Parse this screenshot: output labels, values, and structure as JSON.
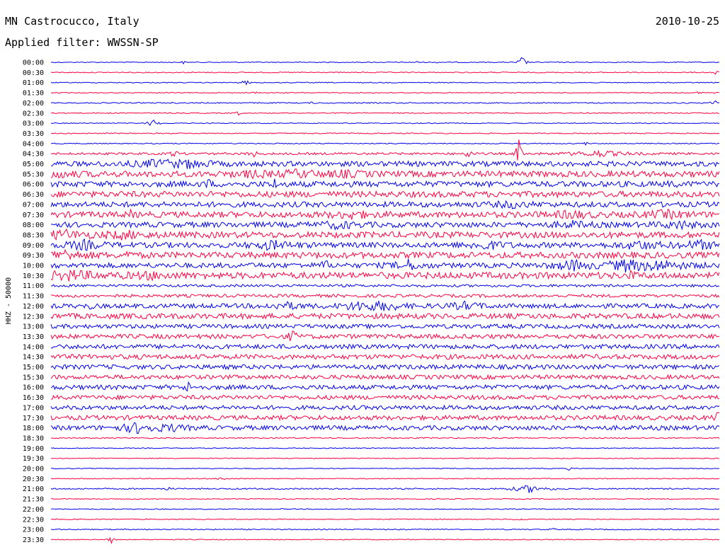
{
  "header": {
    "station": "MN Castrocucco, Italy",
    "filter": "Applied filter: WWSSN-SP",
    "date": "2010-10-25"
  },
  "chart_data": {
    "type": "line",
    "ylabel": "HHZ - 50000",
    "colors": [
      "#0000ee",
      "#ff0040"
    ],
    "rows": [
      {
        "time": "00:00",
        "noise": 0.6,
        "events": [
          {
            "t": 0.198,
            "a": 2,
            "w": 0.002
          },
          {
            "t": 0.547,
            "a": 2,
            "w": 0.002
          },
          {
            "t": 0.58,
            "a": 2,
            "w": 0.002
          },
          {
            "t": 0.705,
            "a": 10,
            "w": 0.004
          }
        ]
      },
      {
        "time": "00:30",
        "noise": 0.7,
        "events": [
          {
            "t": 0.994,
            "a": 7,
            "w": 0.002
          }
        ]
      },
      {
        "time": "01:00",
        "noise": 0.6,
        "events": [
          {
            "t": 0.291,
            "a": 4,
            "w": 0.004
          }
        ]
      },
      {
        "time": "01:30",
        "noise": 0.6,
        "events": [
          {
            "t": 0.305,
            "a": 2,
            "w": 0.002
          },
          {
            "t": 0.97,
            "a": 4,
            "w": 0.002
          }
        ]
      },
      {
        "time": "02:00",
        "noise": 0.8,
        "events": [
          {
            "t": 0.392,
            "a": 2,
            "w": 0.002
          },
          {
            "t": 0.998,
            "a": 14,
            "w": 0.004
          }
        ]
      },
      {
        "time": "02:30",
        "noise": 0.7,
        "events": [
          {
            "t": 0.28,
            "a": 3,
            "w": 0.003
          }
        ]
      },
      {
        "time": "03:00",
        "noise": 0.6,
        "events": [
          {
            "t": 0.153,
            "a": 7,
            "w": 0.005
          }
        ]
      },
      {
        "time": "03:30",
        "noise": 0.7,
        "events": []
      },
      {
        "time": "04:00",
        "noise": 0.7,
        "events": [
          {
            "t": 0.8,
            "a": 3,
            "w": 0.002
          }
        ]
      },
      {
        "time": "04:30",
        "noise": 1.6,
        "events": [
          {
            "t": 0.185,
            "a": 5,
            "w": 0.004
          },
          {
            "t": 0.302,
            "a": 6,
            "w": 0.004
          },
          {
            "t": 0.624,
            "a": 7,
            "w": 0.004
          },
          {
            "t": 0.7,
            "a": 22,
            "w": 0.003
          },
          {
            "t": 0.82,
            "a": 4,
            "w": 0.03
          }
        ]
      },
      {
        "time": "05:00",
        "noise": 3.6,
        "events": [
          {
            "t": 0.16,
            "a": 4,
            "w": 0.03
          },
          {
            "t": 0.21,
            "a": 4,
            "w": 0.02
          }
        ]
      },
      {
        "time": "05:30",
        "noise": 4.2,
        "events": [
          {
            "t": 0.012,
            "a": 3,
            "w": 0.02
          },
          {
            "t": 0.3,
            "a": 3,
            "w": 0.02
          },
          {
            "t": 0.37,
            "a": 4,
            "w": 0.02
          },
          {
            "t": 0.44,
            "a": 3,
            "w": 0.02
          }
        ]
      },
      {
        "time": "06:00",
        "noise": 4.0,
        "events": [
          {
            "t": 0.235,
            "a": 6,
            "w": 0.003
          },
          {
            "t": 0.335,
            "a": 6,
            "w": 0.003
          },
          {
            "t": 0.93,
            "a": 5,
            "w": 0.003
          }
        ]
      },
      {
        "time": "06:30",
        "noise": 4.2,
        "events": []
      },
      {
        "time": "07:00",
        "noise": 3.8,
        "events": [
          {
            "t": 0.69,
            "a": 3,
            "w": 0.02
          }
        ]
      },
      {
        "time": "07:30",
        "noise": 4.2,
        "events": [
          {
            "t": 0.12,
            "a": 4,
            "w": 0.003
          },
          {
            "t": 0.45,
            "a": 4,
            "w": 0.02
          },
          {
            "t": 0.78,
            "a": 4,
            "w": 0.02
          },
          {
            "t": 0.92,
            "a": 4,
            "w": 0.02
          }
        ]
      },
      {
        "time": "08:00",
        "noise": 3.8,
        "events": [
          {
            "t": 0.43,
            "a": 4,
            "w": 0.02
          },
          {
            "t": 0.78,
            "a": 3,
            "w": 0.02
          },
          {
            "t": 0.94,
            "a": 4,
            "w": 0.02
          }
        ]
      },
      {
        "time": "08:30",
        "noise": 4.4,
        "events": [
          {
            "t": 0.02,
            "a": 5,
            "w": 0.02
          },
          {
            "t": 0.11,
            "a": 4,
            "w": 0.02
          }
        ]
      },
      {
        "time": "09:00",
        "noise": 3.8,
        "events": [
          {
            "t": 0.05,
            "a": 5,
            "w": 0.02
          },
          {
            "t": 0.33,
            "a": 5,
            "w": 0.02
          },
          {
            "t": 0.65,
            "a": 5,
            "w": 0.02
          },
          {
            "t": 0.88,
            "a": 5,
            "w": 0.02
          },
          {
            "t": 0.97,
            "a": 5,
            "w": 0.02
          }
        ]
      },
      {
        "time": "09:30",
        "noise": 4.4,
        "events": [
          {
            "t": 0.02,
            "a": 5,
            "w": 0.02
          },
          {
            "t": 0.115,
            "a": 5,
            "w": 0.003
          }
        ]
      },
      {
        "time": "10:00",
        "noise": 3.6,
        "events": [
          {
            "t": 0.41,
            "a": 7,
            "w": 0.004
          },
          {
            "t": 0.535,
            "a": 6,
            "w": 0.015
          },
          {
            "t": 0.78,
            "a": 6,
            "w": 0.02
          },
          {
            "t": 0.86,
            "a": 6,
            "w": 0.02
          },
          {
            "t": 0.91,
            "a": 6,
            "w": 0.03
          }
        ]
      },
      {
        "time": "10:30",
        "noise": 4.6,
        "events": [
          {
            "t": 0.03,
            "a": 5,
            "w": 0.03
          },
          {
            "t": 0.15,
            "a": 3,
            "w": 0.02
          },
          {
            "t": 0.87,
            "a": 10,
            "w": 0.002
          }
        ]
      },
      {
        "time": "11:00",
        "noise": 1.8,
        "events": []
      },
      {
        "time": "11:30",
        "noise": 2.2,
        "events": []
      },
      {
        "time": "12:00",
        "noise": 3.2,
        "events": [
          {
            "t": 0.06,
            "a": 4,
            "w": 0.003
          },
          {
            "t": 0.35,
            "a": 4,
            "w": 0.02
          },
          {
            "t": 0.46,
            "a": 5,
            "w": 0.02
          },
          {
            "t": 0.5,
            "a": 5,
            "w": 0.02
          },
          {
            "t": 0.62,
            "a": 4,
            "w": 0.02
          }
        ]
      },
      {
        "time": "12:30",
        "noise": 3.8,
        "events": []
      },
      {
        "time": "13:00",
        "noise": 3.0,
        "events": []
      },
      {
        "time": "13:30",
        "noise": 3.2,
        "events": [
          {
            "t": 0.362,
            "a": 10,
            "w": 0.004
          }
        ]
      },
      {
        "time": "14:00",
        "noise": 3.2,
        "events": []
      },
      {
        "time": "14:30",
        "noise": 3.4,
        "events": []
      },
      {
        "time": "15:00",
        "noise": 3.2,
        "events": []
      },
      {
        "time": "15:30",
        "noise": 3.0,
        "events": []
      },
      {
        "time": "16:00",
        "noise": 3.2,
        "events": [
          {
            "t": 0.205,
            "a": 7,
            "w": 0.003
          }
        ]
      },
      {
        "time": "16:30",
        "noise": 3.0,
        "events": []
      },
      {
        "time": "17:00",
        "noise": 3.0,
        "events": []
      },
      {
        "time": "17:30",
        "noise": 3.2,
        "events": [
          {
            "t": 0.998,
            "a": 7,
            "w": 0.003
          }
        ]
      },
      {
        "time": "18:00",
        "noise": 3.2,
        "events": [
          {
            "t": 0.13,
            "a": 6,
            "w": 0.02
          },
          {
            "t": 0.18,
            "a": 3,
            "w": 0.02
          }
        ]
      },
      {
        "time": "18:30",
        "noise": 0.8,
        "events": []
      },
      {
        "time": "19:00",
        "noise": 0.6,
        "events": []
      },
      {
        "time": "19:30",
        "noise": 0.6,
        "events": []
      },
      {
        "time": "20:00",
        "noise": 0.6,
        "events": [
          {
            "t": 0.775,
            "a": 2,
            "w": 0.002
          }
        ]
      },
      {
        "time": "20:30",
        "noise": 0.6,
        "events": [
          {
            "t": 0.255,
            "a": 5,
            "w": 0.003
          }
        ]
      },
      {
        "time": "21:00",
        "noise": 0.9,
        "events": [
          {
            "t": 0.175,
            "a": 2,
            "w": 0.005
          },
          {
            "t": 0.715,
            "a": 5,
            "w": 0.02
          }
        ]
      },
      {
        "time": "21:30",
        "noise": 0.6,
        "events": []
      },
      {
        "time": "22:00",
        "noise": 0.6,
        "events": []
      },
      {
        "time": "22:30",
        "noise": 0.6,
        "events": [
          {
            "t": 0.7,
            "a": 4,
            "w": 0.003
          }
        ]
      },
      {
        "time": "23:00",
        "noise": 0.7,
        "events": [
          {
            "t": 0.75,
            "a": 3,
            "w": 0.002
          }
        ]
      },
      {
        "time": "23:30",
        "noise": 0.6,
        "events": [
          {
            "t": 0.09,
            "a": 5,
            "w": 0.003
          }
        ]
      }
    ]
  }
}
